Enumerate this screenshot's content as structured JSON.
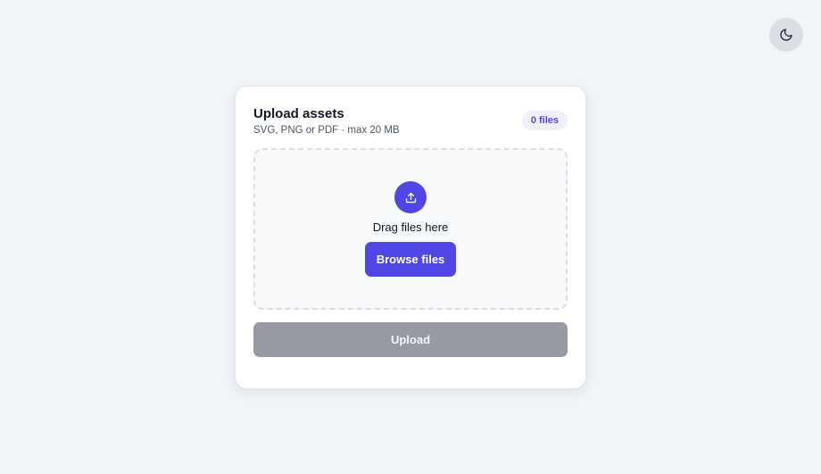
{
  "theme_toggle": {
    "icon": "moon-icon"
  },
  "card": {
    "title": "Upload assets",
    "subtitle": "SVG, PNG or PDF · max 20 MB",
    "file_count": "0 files"
  },
  "dropzone": {
    "icon": "upload-icon",
    "label": "Drag files here",
    "browse_label": "Browse files"
  },
  "upload_button": {
    "label": "Upload",
    "disabled": true
  },
  "colors": {
    "background": "#f1f4f9",
    "accent": "#4f46e5",
    "disabled": "#979aa1",
    "badge_bg": "#eef0fb"
  }
}
